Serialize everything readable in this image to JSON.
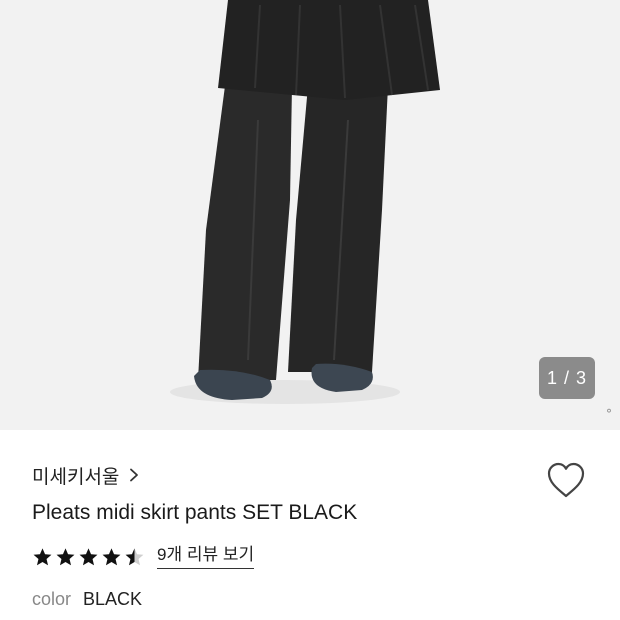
{
  "gallery": {
    "page_indicator": "1 / 3",
    "image_name": "product-photo"
  },
  "product": {
    "brand": "미세키서울",
    "title": "Pleats midi skirt pants SET BLACK",
    "rating": 4.5,
    "review_link": "9개 리뷰 보기",
    "color_label": "color",
    "color_value": "BLACK"
  },
  "icons": {
    "brand": "chevron-right-icon",
    "wishlist": "heart-outline-icon",
    "rating": "star-icon"
  }
}
